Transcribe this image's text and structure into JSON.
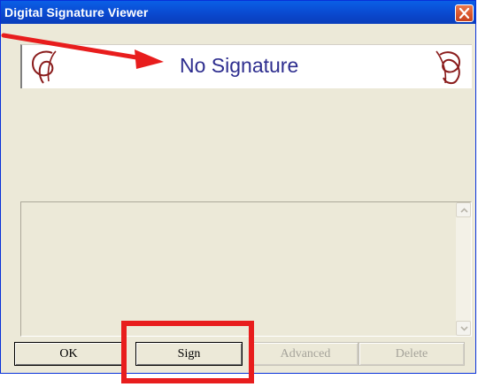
{
  "window": {
    "title": "Digital Signature Viewer"
  },
  "signature": {
    "status_text": "No Signature"
  },
  "buttons": {
    "ok": "OK",
    "sign": "Sign",
    "advanced": "Advanced",
    "delete": "Delete"
  },
  "icons": {
    "close": "close-icon",
    "flourish_left": "flourish-icon",
    "flourish_right": "flourish-icon",
    "scroll_up": "chevron-up-icon",
    "scroll_down": "chevron-down-icon"
  },
  "annotation_colors": {
    "highlight": "#e81d1d"
  }
}
